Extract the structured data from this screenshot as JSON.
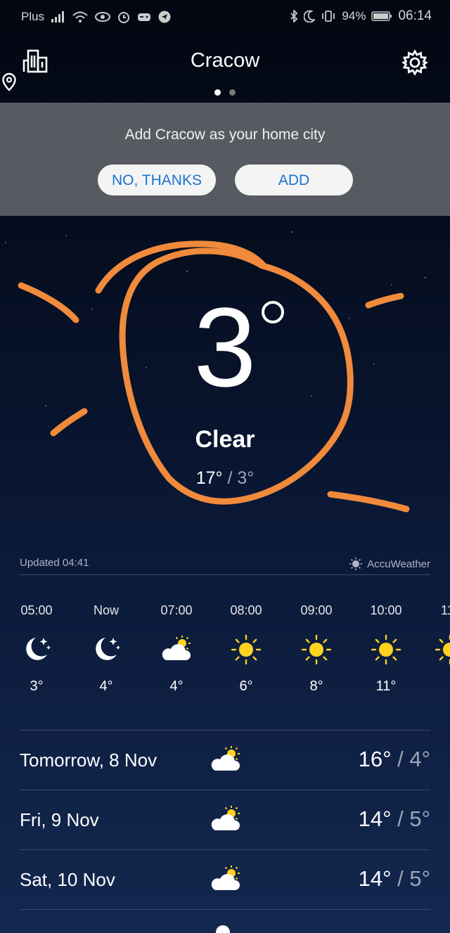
{
  "status_bar": {
    "carrier": "Plus",
    "battery": "94%",
    "time": "06:14"
  },
  "header": {
    "city": "Cracow"
  },
  "banner": {
    "message": "Add Cracow as your home city",
    "no_label": "NO, THANKS",
    "add_label": "ADD"
  },
  "current": {
    "temperature": "3",
    "condition": "Clear",
    "high": "17°",
    "low": "3°"
  },
  "updated": {
    "text": "Updated 04:41",
    "provider": "AccuWeather"
  },
  "hourly": [
    {
      "time": "05:00",
      "icon": "moon-stars-icon",
      "temp": "3°"
    },
    {
      "time": "Now",
      "icon": "moon-stars-icon",
      "temp": "4°"
    },
    {
      "time": "07:00",
      "icon": "sun-cloud-icon",
      "temp": "4°"
    },
    {
      "time": "08:00",
      "icon": "sun-icon",
      "temp": "6°"
    },
    {
      "time": "09:00",
      "icon": "sun-icon",
      "temp": "8°"
    },
    {
      "time": "10:00",
      "icon": "sun-icon",
      "temp": "11°"
    },
    {
      "time": "11",
      "icon": "sun-icon",
      "temp": ""
    }
  ],
  "daily": [
    {
      "day": "Tomorrow, 8 Nov",
      "icon": "sun-cloud-icon",
      "high": "16°",
      "low": "4°"
    },
    {
      "day": "Fri, 9 Nov",
      "icon": "sun-cloud-icon",
      "high": "14°",
      "low": "5°"
    },
    {
      "day": "Sat, 10 Nov",
      "icon": "sun-cloud-icon",
      "high": "14°",
      "low": "5°"
    }
  ],
  "colors": {
    "annotation": "#f08a3c",
    "button_text": "#1a73d0",
    "banner_bg": "#575b61",
    "sun": "#ffd21f"
  }
}
